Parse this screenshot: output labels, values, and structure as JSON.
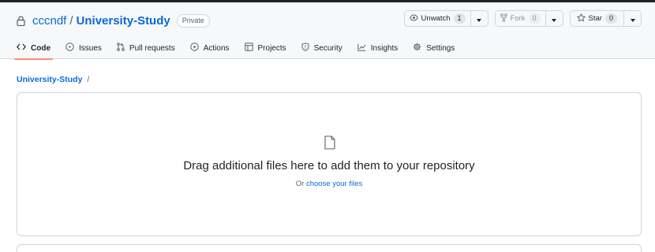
{
  "repo": {
    "owner": "cccndf",
    "separator": "/",
    "name": "University-Study",
    "visibility": "Private"
  },
  "actions": {
    "watch": {
      "label": "Unwatch",
      "count": "1"
    },
    "fork": {
      "label": "Fork",
      "count": "0"
    },
    "star": {
      "label": "Star",
      "count": "0"
    }
  },
  "tabs": [
    {
      "label": "Code",
      "icon": "code-icon",
      "active": true
    },
    {
      "label": "Issues",
      "icon": "issue-icon"
    },
    {
      "label": "Pull requests",
      "icon": "pull-request-icon"
    },
    {
      "label": "Actions",
      "icon": "play-icon"
    },
    {
      "label": "Projects",
      "icon": "table-icon"
    },
    {
      "label": "Security",
      "icon": "shield-icon"
    },
    {
      "label": "Insights",
      "icon": "graph-icon"
    },
    {
      "label": "Settings",
      "icon": "gear-icon"
    }
  ],
  "breadcrumb": {
    "repo": "University-Study",
    "separator": "/"
  },
  "dropzone": {
    "title": "Drag additional files here to add them to your repository",
    "prefix": "Or",
    "link": "choose your files"
  },
  "colors": {
    "link": "#0969da",
    "active_tab_underline": "#fd8c73",
    "border": "#d0d7de"
  }
}
